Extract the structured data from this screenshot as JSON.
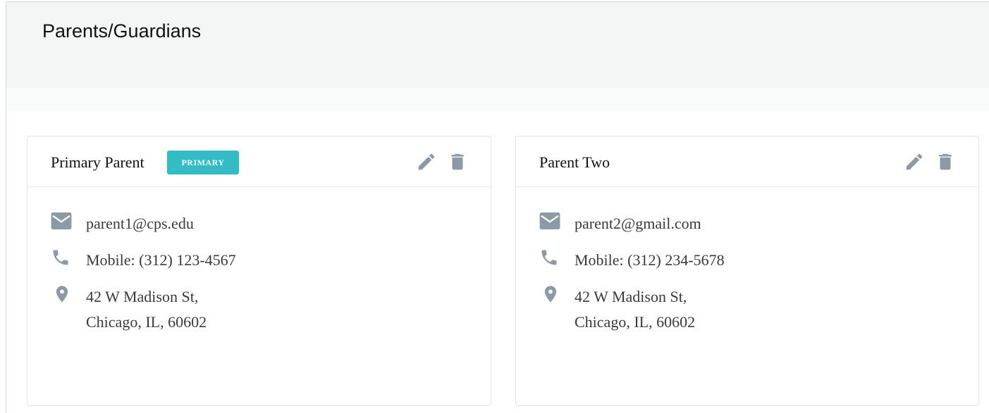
{
  "page": {
    "title": "Parents/Guardians"
  },
  "colors": {
    "badge": "#33bcc4",
    "icon": "#8c9aa8",
    "header_bg": "#f4f5f5"
  },
  "guardians": [
    {
      "name": "Primary Parent",
      "badge": "PRIMARY",
      "email": "parent1@cps.edu",
      "phone": "Mobile: (312) 123-4567",
      "address_line1": "42 W Madison St,",
      "address_line2": "Chicago, IL, 60602",
      "icons": {
        "edit": "pencil-icon",
        "delete": "trash-icon",
        "email": "envelope-icon",
        "phone": "phone-icon",
        "address": "map-pin-icon"
      }
    },
    {
      "name": "Parent Two",
      "email": "parent2@gmail.com",
      "phone": "Mobile: (312) 234-5678",
      "address_line1": "42 W Madison St,",
      "address_line2": "Chicago, IL, 60602",
      "icons": {
        "edit": "pencil-icon",
        "delete": "trash-icon",
        "email": "envelope-icon",
        "phone": "phone-icon",
        "address": "map-pin-icon"
      }
    }
  ]
}
